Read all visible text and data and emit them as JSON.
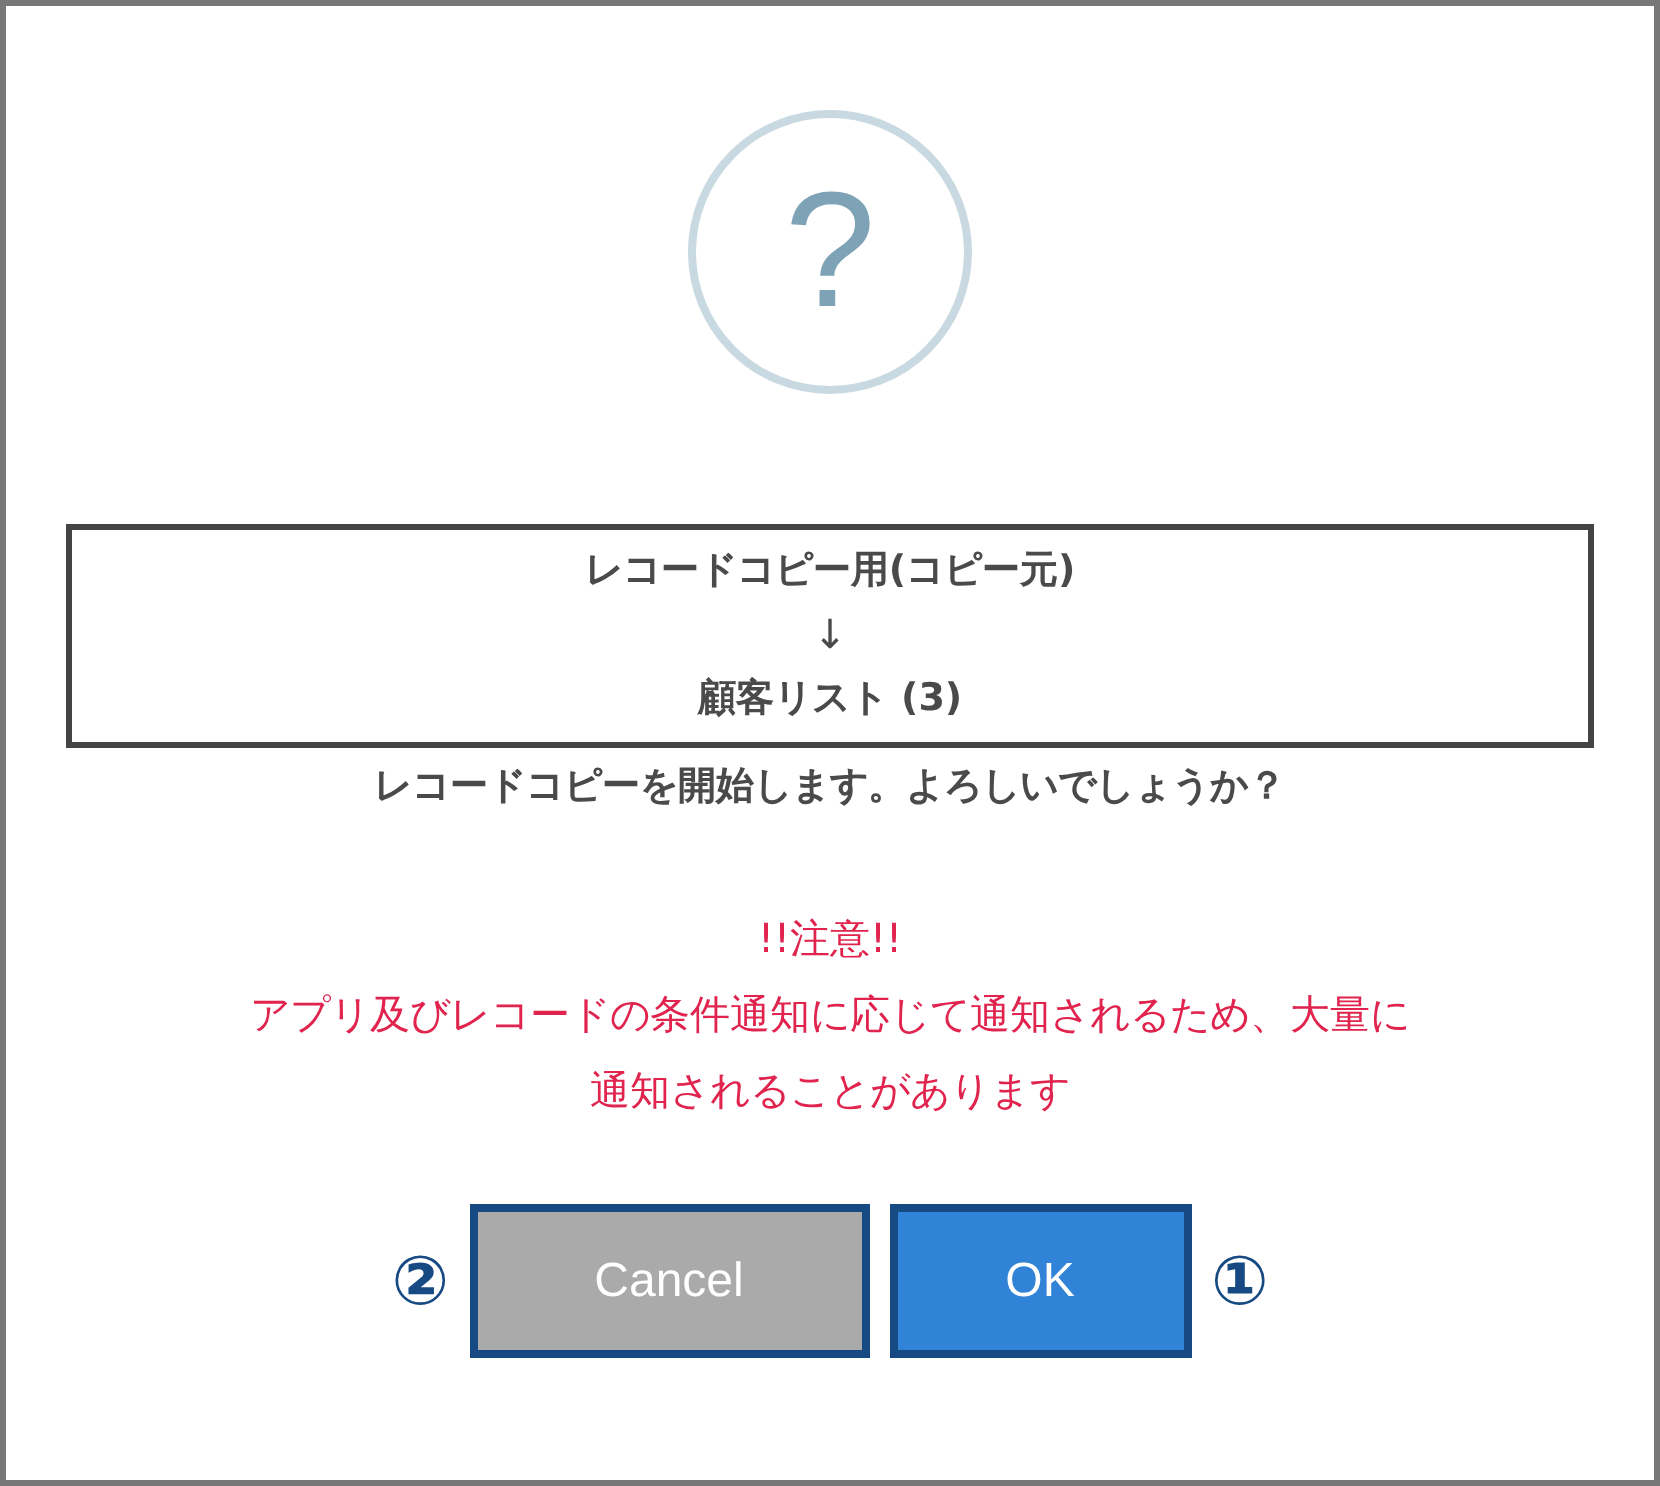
{
  "icon": {
    "glyph": "?"
  },
  "copy_box": {
    "source": "レコードコピー用(コピー元)",
    "arrow": "↓",
    "target": "顧客リスト (3)"
  },
  "question": "レコードコピーを開始します。よろしいでしょうか？",
  "warning": {
    "title": "!!注意!!",
    "lines": [
      "アプリ及びレコードの条件通知に応じて通知されるため、大量に",
      "通知されることがあります"
    ]
  },
  "button_row": [
    {
      "kind": "marker",
      "text": "②"
    },
    {
      "kind": "cancel",
      "text": "Cancel"
    },
    {
      "kind": "primary",
      "text": "OK"
    },
    {
      "kind": "marker",
      "text": "①"
    }
  ]
}
